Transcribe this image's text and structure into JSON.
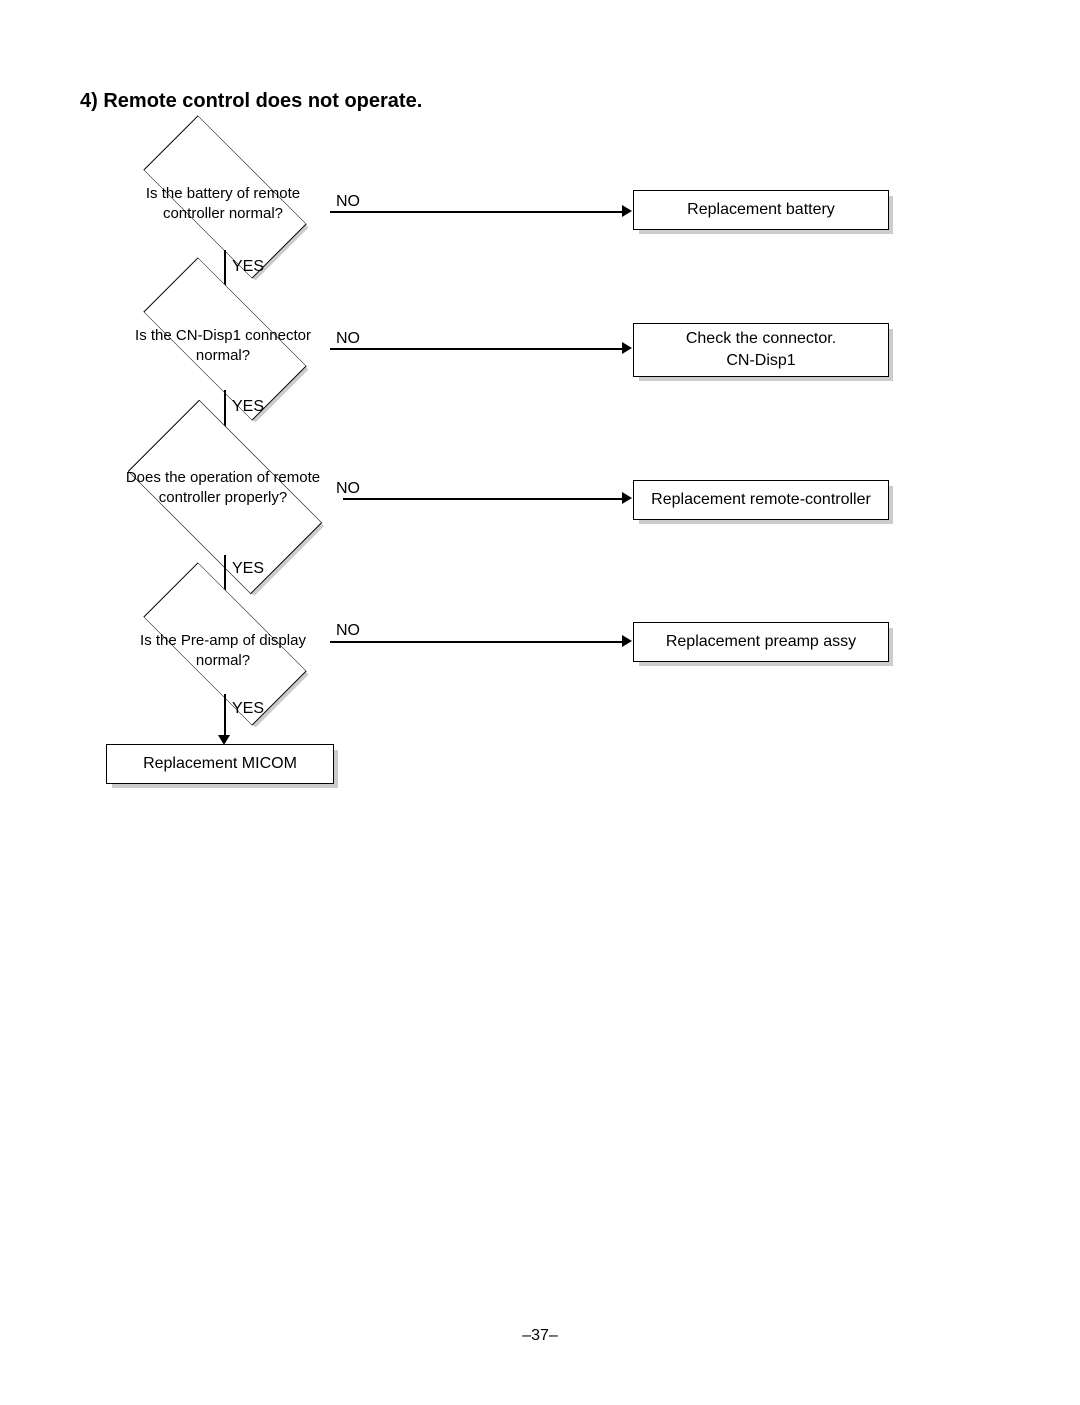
{
  "title": "4) Remote control does not operate.",
  "labels": {
    "yes": "YES",
    "no": "NO"
  },
  "decisions": {
    "d1": "Is the battery of remote controller normal?",
    "d2": "Is the CN-Disp1 connector normal?",
    "d3": "Does the operation of remote controller properly?",
    "d4": "Is the Pre-amp of display normal?"
  },
  "actions": {
    "a1": "Replacement battery",
    "a2": "Check the connector.\nCN-Disp1",
    "a3": "Replacement remote-controller",
    "a4": "Replacement preamp assy",
    "end": "Replacement MICOM"
  },
  "page_number": "–37–"
}
